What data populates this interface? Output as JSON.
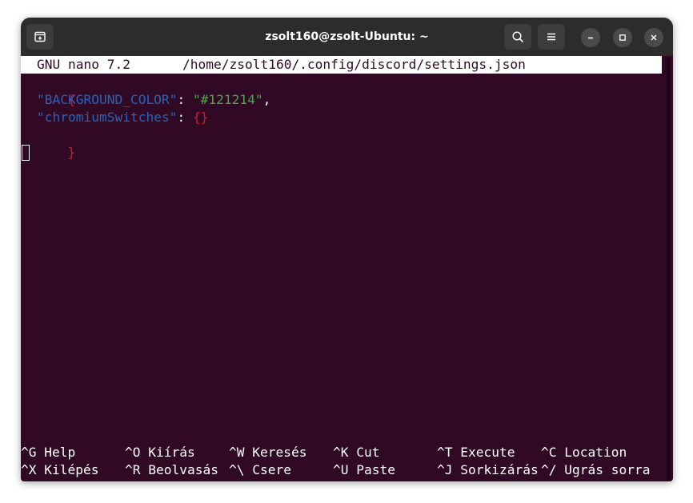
{
  "window": {
    "title": "zsolt160@zsolt-Ubuntu: ~"
  },
  "titlebar": {
    "new_tab_icon": "new-tab-icon",
    "search_icon": "search-icon",
    "menu_icon": "hamburger-menu-icon",
    "minimize_icon": "minimize-icon",
    "maximize_icon": "maximize-icon",
    "close_icon": "close-icon"
  },
  "nano": {
    "version": "GNU nano 7.2",
    "file_path": "/home/zsolt160/.config/discord/settings.json",
    "content": {
      "open_brace": "{",
      "line1_key": "\"BACKGROUND_COLOR\"",
      "line1_colon": ":",
      "line1_value": "\"#121214\"",
      "line1_comma": ",",
      "line2_key": "\"chromiumSwitches\"",
      "line2_colon": ":",
      "line2_value": "{}",
      "close_brace": "}"
    },
    "shortcuts_row1": [
      {
        "key": "^G",
        "label": "Help"
      },
      {
        "key": "^O",
        "label": "Kiírás"
      },
      {
        "key": "^W",
        "label": "Keresés"
      },
      {
        "key": "^K",
        "label": "Cut"
      },
      {
        "key": "^T",
        "label": "Execute"
      },
      {
        "key": "^C",
        "label": "Location"
      }
    ],
    "shortcuts_row2": [
      {
        "key": "^X",
        "label": "Kilépés"
      },
      {
        "key": "^R",
        "label": "Beolvasás"
      },
      {
        "key": "^\\",
        "label": "Csere"
      },
      {
        "key": "^U",
        "label": "Paste"
      },
      {
        "key": "^J",
        "label": "Sorkizárás"
      },
      {
        "key": "^/",
        "label": "Ugrás sorra"
      }
    ]
  },
  "colors": {
    "terminal_bg": "#300a24",
    "titlebar_bg": "#2c2c2c",
    "json_key": "#2a62b8",
    "json_string": "#4ea34e",
    "json_brace": "#d01c2c"
  }
}
